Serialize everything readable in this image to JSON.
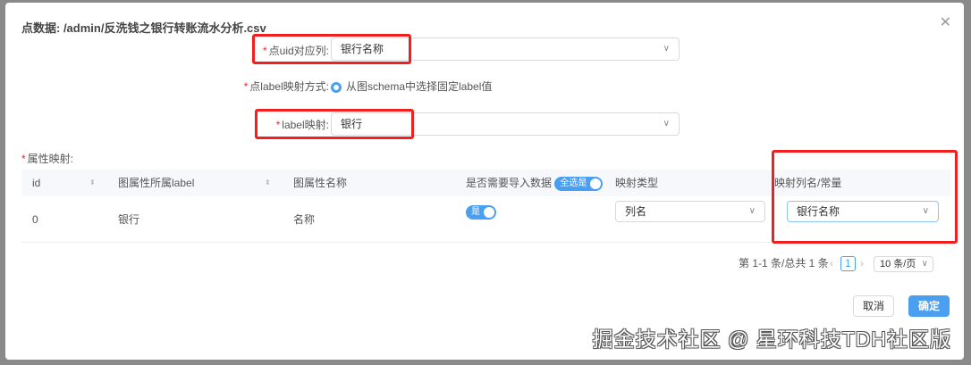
{
  "dialog": {
    "title": "点数据: /admin/反洗钱之银行转账流水分析.csv",
    "close_icon": "close-icon"
  },
  "form": {
    "uid_label": "点uid对应列:",
    "uid_value": "银行名称",
    "label_mode_label": "点label映射方式:",
    "label_mode_option": "从图schema中选择固定label值",
    "label_map_label": "label映射:",
    "label_map_value": "银行",
    "props_label": "属性映射:"
  },
  "table": {
    "headers": [
      "id",
      "图属性所属label",
      "图属性名称",
      "是否需要导入数据",
      "映射类型",
      "映射列名/常量"
    ],
    "select_all_toggle": "全选是",
    "rows": [
      {
        "id": "0",
        "label": "银行",
        "name": "名称",
        "import": "是",
        "map_type": "列名",
        "map_value": "银行名称"
      }
    ]
  },
  "pagination": {
    "summary": "第 1-1 条/总共 1 条",
    "page": "1",
    "page_size": "10 条/页"
  },
  "footer": {
    "cancel": "取消",
    "ok": "确定"
  },
  "watermark": "掘金技术社区 @ 星环科技TDH社区版"
}
